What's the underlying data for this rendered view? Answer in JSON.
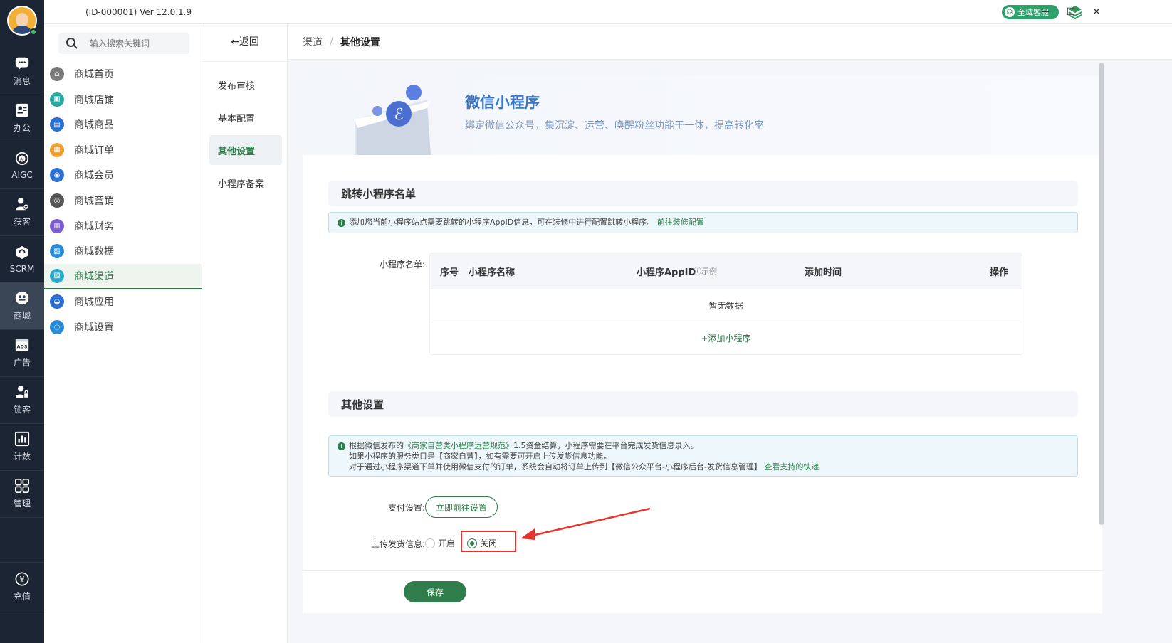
{
  "titlebar": {
    "app_id": "(ID-000001)  Ver 12.0.1.9",
    "service": "全域客服",
    "minimize": "─",
    "maximize": "☐",
    "close": "✕"
  },
  "rail": [
    {
      "label": "消息",
      "icon": "message-icon"
    },
    {
      "label": "办公",
      "icon": "office-icon"
    },
    {
      "label": "AIGC",
      "icon": "aigc-icon"
    },
    {
      "label": "获客",
      "icon": "acquire-icon"
    },
    {
      "label": "SCRM",
      "icon": "scrm-icon"
    },
    {
      "label": "商城",
      "icon": "mall-icon"
    },
    {
      "label": "广告",
      "icon": "ads-icon"
    },
    {
      "label": "锁客",
      "icon": "lock-customer-icon"
    },
    {
      "label": "计数",
      "icon": "stats-icon"
    },
    {
      "label": "管理",
      "icon": "manage-icon"
    }
  ],
  "rail_bottom": {
    "label": "充值",
    "icon": "recharge-icon"
  },
  "search": {
    "placeholder": "输入搜索关键词"
  },
  "menu": [
    {
      "label": "商城首页",
      "color": "#7a7a7a"
    },
    {
      "label": "商城店铺",
      "color": "#2aa9a0"
    },
    {
      "label": "商城商品",
      "color": "#2a6fd6"
    },
    {
      "label": "商城订单",
      "color": "#f0a030"
    },
    {
      "label": "商城会员",
      "color": "#2a6fd6"
    },
    {
      "label": "商城营销",
      "color": "#555555"
    },
    {
      "label": "商城财务",
      "color": "#7b5bd1"
    },
    {
      "label": "商城数据",
      "color": "#2a8ad6"
    },
    {
      "label": "商城渠道",
      "color": "#2aa9c8"
    },
    {
      "label": "商城应用",
      "color": "#2a6fd6"
    },
    {
      "label": "商城设置",
      "color": "#2a8ad6"
    }
  ],
  "submenu": {
    "back": "←返回",
    "items": [
      "发布审核",
      "基本配置",
      "其他设置",
      "小程序备案"
    ]
  },
  "breadcrumb": {
    "first": "渠道",
    "separator": "/",
    "current": "其他设置"
  },
  "banner": {
    "title": "微信小程序",
    "desc": "绑定微信公众号，集沉淀、运营、唤醒粉丝功能于一体，提高转化率"
  },
  "section1": {
    "title": "跳转小程序名单",
    "notice": "添加您当前小程序站点需要跳转的小程序AppID信息，可在装修中进行配置跳转小程序。",
    "notice_link": "前往装修配置",
    "label": "小程序名单:",
    "columns": {
      "no": "序号",
      "name": "小程序名称",
      "appid": "小程序AppID",
      "hint": "ⓘ示例",
      "time": "添加时间",
      "op": "操作"
    },
    "empty": "暂无数据",
    "add": "+添加小程序"
  },
  "section2": {
    "title": "其他设置",
    "notice_l1a": "根据微信发布的",
    "notice_l1b": "《商家自营类小程序运营规范》",
    "notice_l1c": "1.5资金结算，小程序需要在平台完成发货信息录入。",
    "notice_l2": "如果小程序的服务类目是【商家自营】，如有需要可开启上传发货信息功能。",
    "notice_l3": "对于通过小程序渠道下单并使用微信支付的订单，系统会自动将订单上传到【微信公众平台-小程序后台-发货信息管理】",
    "notice_l3_link": "查看支持的快递",
    "pay_label": "支付设置:",
    "pay_button": "立即前往设置",
    "upload_label": "上传发货信息:",
    "opt_on": "开启",
    "opt_off": "关闭",
    "selected": "关闭"
  },
  "footer": {
    "save": "保存"
  },
  "colors": {
    "accent": "#2e7d4a",
    "rail_bg": "#1c2533",
    "highlight": "#e8332c"
  }
}
